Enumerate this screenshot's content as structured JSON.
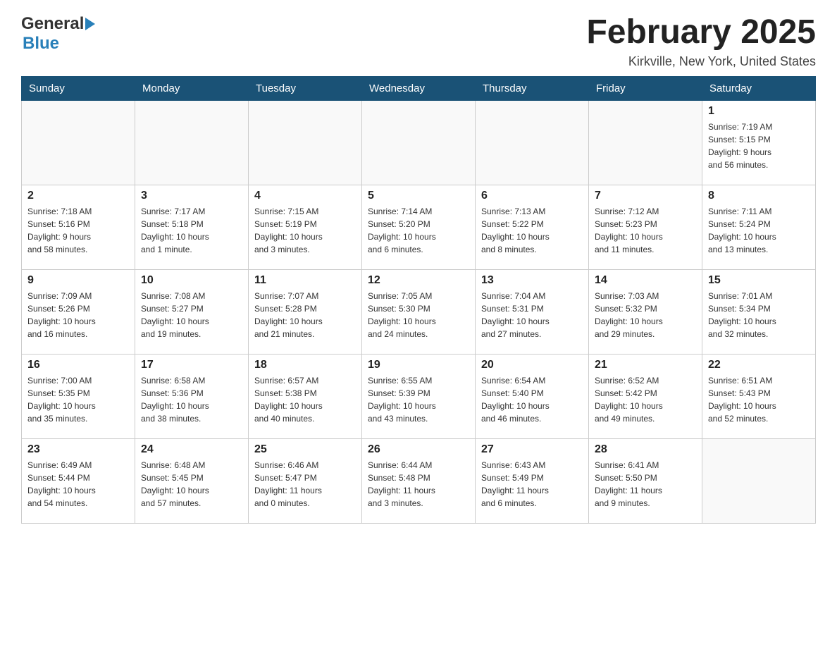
{
  "header": {
    "logo_general": "General",
    "logo_blue": "Blue",
    "month_title": "February 2025",
    "location": "Kirkville, New York, United States"
  },
  "weekdays": [
    "Sunday",
    "Monday",
    "Tuesday",
    "Wednesday",
    "Thursday",
    "Friday",
    "Saturday"
  ],
  "weeks": [
    [
      {
        "day": "",
        "info": ""
      },
      {
        "day": "",
        "info": ""
      },
      {
        "day": "",
        "info": ""
      },
      {
        "day": "",
        "info": ""
      },
      {
        "day": "",
        "info": ""
      },
      {
        "day": "",
        "info": ""
      },
      {
        "day": "1",
        "info": "Sunrise: 7:19 AM\nSunset: 5:15 PM\nDaylight: 9 hours\nand 56 minutes."
      }
    ],
    [
      {
        "day": "2",
        "info": "Sunrise: 7:18 AM\nSunset: 5:16 PM\nDaylight: 9 hours\nand 58 minutes."
      },
      {
        "day": "3",
        "info": "Sunrise: 7:17 AM\nSunset: 5:18 PM\nDaylight: 10 hours\nand 1 minute."
      },
      {
        "day": "4",
        "info": "Sunrise: 7:15 AM\nSunset: 5:19 PM\nDaylight: 10 hours\nand 3 minutes."
      },
      {
        "day": "5",
        "info": "Sunrise: 7:14 AM\nSunset: 5:20 PM\nDaylight: 10 hours\nand 6 minutes."
      },
      {
        "day": "6",
        "info": "Sunrise: 7:13 AM\nSunset: 5:22 PM\nDaylight: 10 hours\nand 8 minutes."
      },
      {
        "day": "7",
        "info": "Sunrise: 7:12 AM\nSunset: 5:23 PM\nDaylight: 10 hours\nand 11 minutes."
      },
      {
        "day": "8",
        "info": "Sunrise: 7:11 AM\nSunset: 5:24 PM\nDaylight: 10 hours\nand 13 minutes."
      }
    ],
    [
      {
        "day": "9",
        "info": "Sunrise: 7:09 AM\nSunset: 5:26 PM\nDaylight: 10 hours\nand 16 minutes."
      },
      {
        "day": "10",
        "info": "Sunrise: 7:08 AM\nSunset: 5:27 PM\nDaylight: 10 hours\nand 19 minutes."
      },
      {
        "day": "11",
        "info": "Sunrise: 7:07 AM\nSunset: 5:28 PM\nDaylight: 10 hours\nand 21 minutes."
      },
      {
        "day": "12",
        "info": "Sunrise: 7:05 AM\nSunset: 5:30 PM\nDaylight: 10 hours\nand 24 minutes."
      },
      {
        "day": "13",
        "info": "Sunrise: 7:04 AM\nSunset: 5:31 PM\nDaylight: 10 hours\nand 27 minutes."
      },
      {
        "day": "14",
        "info": "Sunrise: 7:03 AM\nSunset: 5:32 PM\nDaylight: 10 hours\nand 29 minutes."
      },
      {
        "day": "15",
        "info": "Sunrise: 7:01 AM\nSunset: 5:34 PM\nDaylight: 10 hours\nand 32 minutes."
      }
    ],
    [
      {
        "day": "16",
        "info": "Sunrise: 7:00 AM\nSunset: 5:35 PM\nDaylight: 10 hours\nand 35 minutes."
      },
      {
        "day": "17",
        "info": "Sunrise: 6:58 AM\nSunset: 5:36 PM\nDaylight: 10 hours\nand 38 minutes."
      },
      {
        "day": "18",
        "info": "Sunrise: 6:57 AM\nSunset: 5:38 PM\nDaylight: 10 hours\nand 40 minutes."
      },
      {
        "day": "19",
        "info": "Sunrise: 6:55 AM\nSunset: 5:39 PM\nDaylight: 10 hours\nand 43 minutes."
      },
      {
        "day": "20",
        "info": "Sunrise: 6:54 AM\nSunset: 5:40 PM\nDaylight: 10 hours\nand 46 minutes."
      },
      {
        "day": "21",
        "info": "Sunrise: 6:52 AM\nSunset: 5:42 PM\nDaylight: 10 hours\nand 49 minutes."
      },
      {
        "day": "22",
        "info": "Sunrise: 6:51 AM\nSunset: 5:43 PM\nDaylight: 10 hours\nand 52 minutes."
      }
    ],
    [
      {
        "day": "23",
        "info": "Sunrise: 6:49 AM\nSunset: 5:44 PM\nDaylight: 10 hours\nand 54 minutes."
      },
      {
        "day": "24",
        "info": "Sunrise: 6:48 AM\nSunset: 5:45 PM\nDaylight: 10 hours\nand 57 minutes."
      },
      {
        "day": "25",
        "info": "Sunrise: 6:46 AM\nSunset: 5:47 PM\nDaylight: 11 hours\nand 0 minutes."
      },
      {
        "day": "26",
        "info": "Sunrise: 6:44 AM\nSunset: 5:48 PM\nDaylight: 11 hours\nand 3 minutes."
      },
      {
        "day": "27",
        "info": "Sunrise: 6:43 AM\nSunset: 5:49 PM\nDaylight: 11 hours\nand 6 minutes."
      },
      {
        "day": "28",
        "info": "Sunrise: 6:41 AM\nSunset: 5:50 PM\nDaylight: 11 hours\nand 9 minutes."
      },
      {
        "day": "",
        "info": ""
      }
    ]
  ]
}
